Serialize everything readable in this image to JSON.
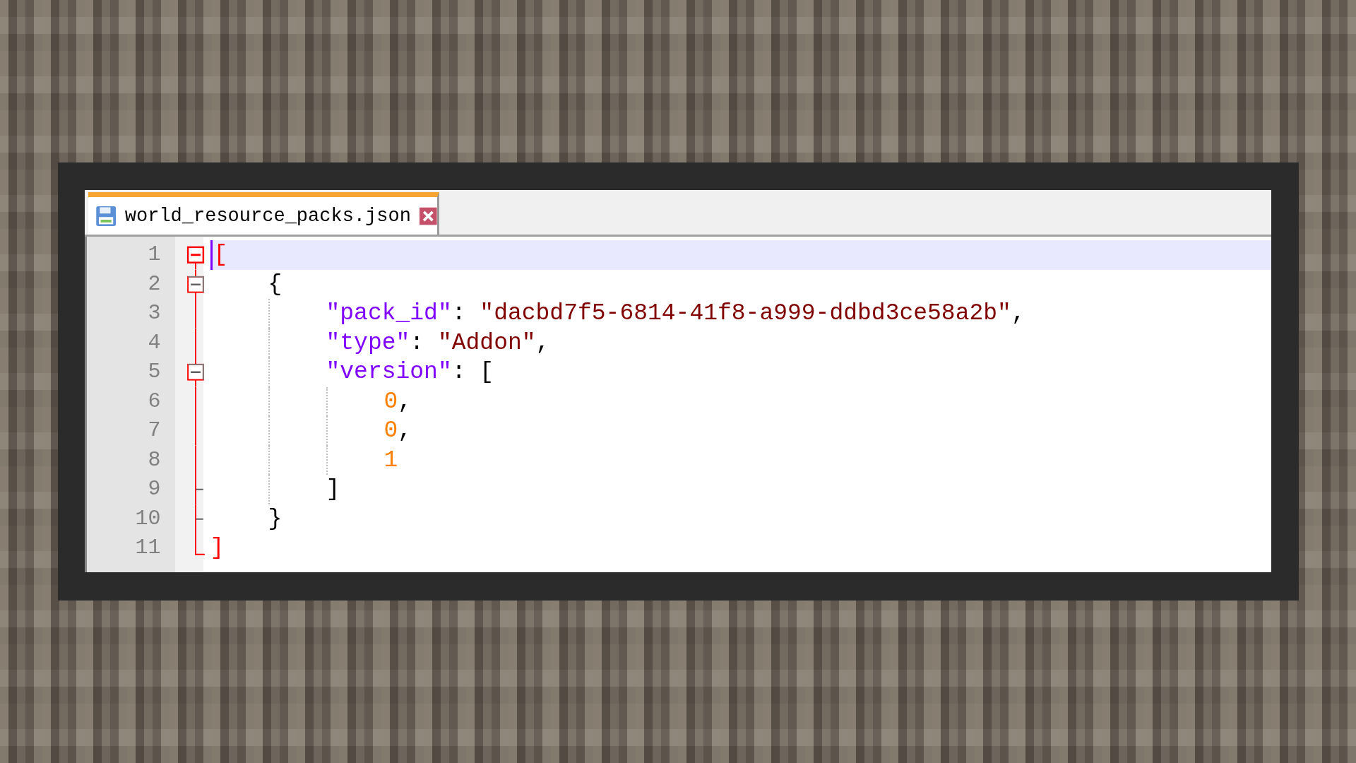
{
  "tab": {
    "label": "world_resource_packs.json",
    "selected": true
  },
  "lines": [
    {
      "number": "1",
      "kind": "open-root",
      "current": true,
      "tokens": [
        {
          "text": "[",
          "kind": "brace-match"
        }
      ]
    },
    {
      "number": "2",
      "kind": "open",
      "current": false,
      "tokens": [
        {
          "text": "{",
          "kind": "punct"
        }
      ]
    },
    {
      "number": "3",
      "kind": "middle",
      "current": false,
      "tokens": [
        {
          "text": "\"pack_id\"",
          "kind": "key"
        },
        {
          "text": ": ",
          "kind": "punct"
        },
        {
          "text": "\"dacbd7f5-6814-41f8-a999-ddbd3ce58a2b\"",
          "kind": "string"
        },
        {
          "text": ",",
          "kind": "punct"
        }
      ]
    },
    {
      "number": "4",
      "kind": "middle",
      "current": false,
      "tokens": [
        {
          "text": "\"type\"",
          "kind": "key"
        },
        {
          "text": ": ",
          "kind": "punct"
        },
        {
          "text": "\"Addon\"",
          "kind": "string"
        },
        {
          "text": ",",
          "kind": "punct"
        }
      ]
    },
    {
      "number": "5",
      "kind": "open",
      "current": false,
      "tokens": [
        {
          "text": "\"version\"",
          "kind": "key"
        },
        {
          "text": ": [",
          "kind": "punct"
        }
      ]
    },
    {
      "number": "6",
      "kind": "middle",
      "current": false,
      "tokens": [
        {
          "text": "0",
          "kind": "number"
        },
        {
          "text": ",",
          "kind": "punct"
        }
      ]
    },
    {
      "number": "7",
      "kind": "middle",
      "current": false,
      "tokens": [
        {
          "text": "0",
          "kind": "number"
        },
        {
          "text": ",",
          "kind": "punct"
        }
      ]
    },
    {
      "number": "8",
      "kind": "middle",
      "current": false,
      "tokens": [
        {
          "text": "1",
          "kind": "number"
        }
      ]
    },
    {
      "number": "9",
      "kind": "end",
      "current": false,
      "tokens": [
        {
          "text": "]",
          "kind": "punct"
        }
      ]
    },
    {
      "number": "10",
      "kind": "end",
      "current": false,
      "tokens": [
        {
          "text": "}",
          "kind": "punct"
        }
      ]
    },
    {
      "number": "11",
      "kind": "end-root",
      "current": false,
      "tokens": [
        {
          "text": "]",
          "kind": "brace-match"
        }
      ]
    }
  ]
}
